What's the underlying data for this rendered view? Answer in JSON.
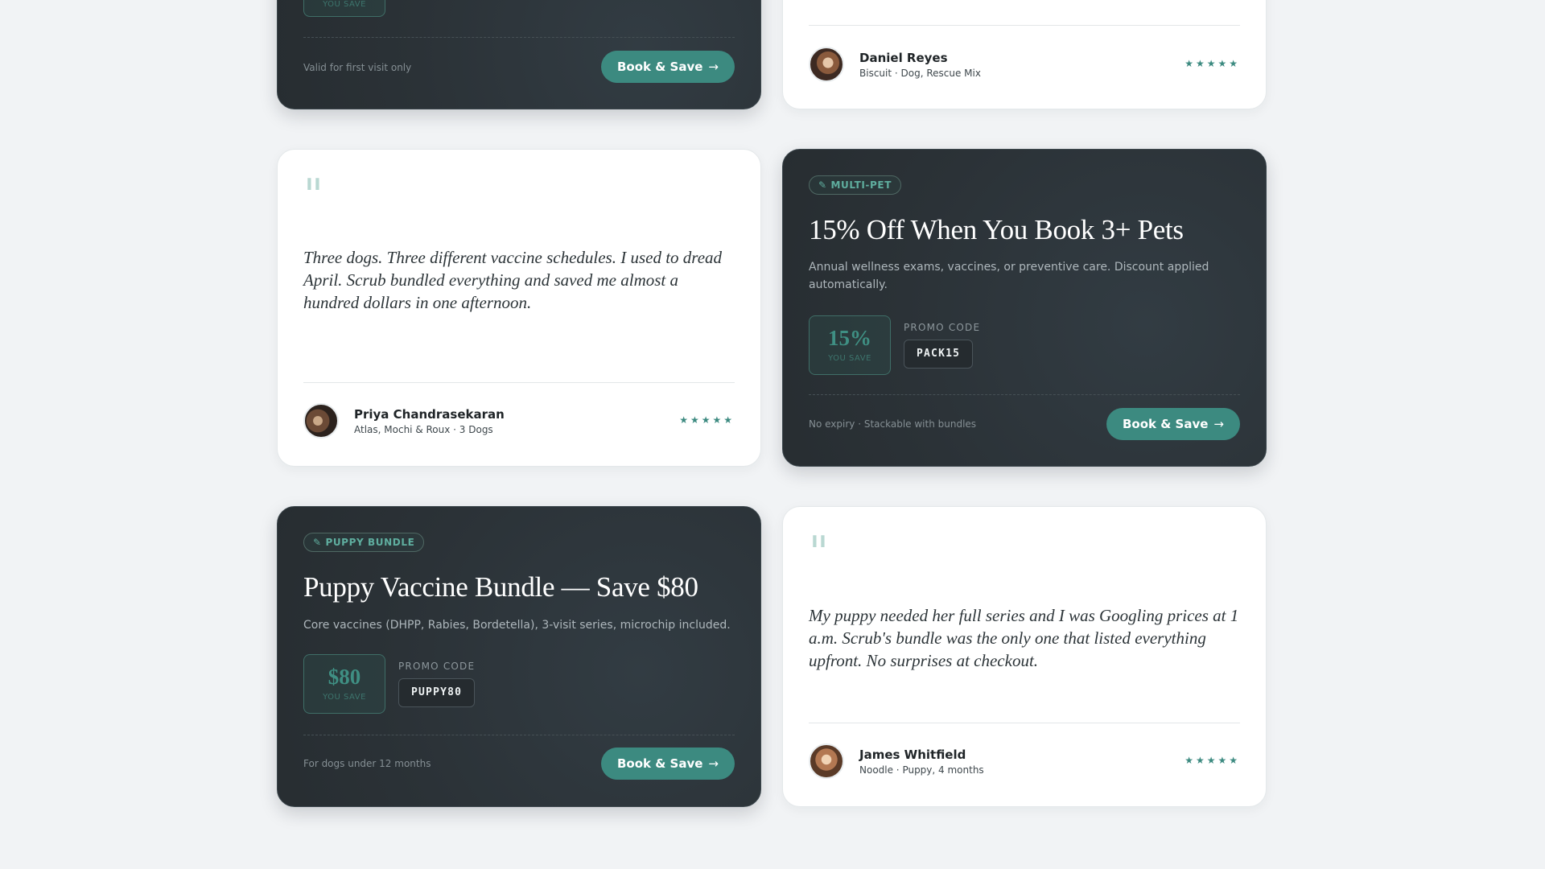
{
  "deals": [
    {
      "tag": null,
      "title": null,
      "description": null,
      "savings": "",
      "savings_label": "YOU SAVE",
      "promo_label": null,
      "promo_code": "",
      "note": "Valid for first visit only",
      "button": "Book & Save",
      "arrow": "→"
    },
    {
      "tag": "MULTI-PET",
      "title": "15% Off When You Book 3+ Pets",
      "description": "Annual wellness exams, vaccines, or preventive care. Discount applied automatically.",
      "savings": "15%",
      "savings_label": "YOU SAVE",
      "promo_label": "PROMO CODE",
      "promo_code": "PACK15",
      "note": "No expiry · Stackable with bundles",
      "button": "Book & Save",
      "arrow": "→"
    },
    {
      "tag": "PUPPY BUNDLE",
      "title": "Puppy Vaccine Bundle — Save $80",
      "description": "Core vaccines (DHPP, Rabies, Bordetella), 3-visit series, microchip included.",
      "savings": "$80",
      "savings_label": "YOU SAVE",
      "promo_label": "PROMO CODE",
      "promo_code": "PUPPY80",
      "note": "For dogs under 12 months",
      "button": "Book & Save",
      "arrow": "→"
    }
  ],
  "testimonials": [
    {
      "quote_mark": null,
      "quote": null,
      "name": "Daniel Reyes",
      "meta": "Biscuit · Dog, Rescue Mix",
      "stars": "★★★★★",
      "rating": 5
    },
    {
      "quote_mark": "\"",
      "quote": "Three dogs. Three different vaccine schedules. I used to dread April. Scrub bundled everything and saved me almost a hundred dollars in one afternoon.",
      "name": "Priya Chandrasekaran",
      "meta": "Atlas, Mochi & Roux · 3 Dogs",
      "stars": "★★★★★",
      "rating": 5
    },
    {
      "quote_mark": "\"",
      "quote": "My puppy needed her full series and I was Googling prices at 1 a.m. Scrub's bundle was the only one that listed everything upfront. No surprises at checkout.",
      "name": "James Whitfield",
      "meta": "Noodle · Puppy, 4 months",
      "stars": "★★★★★",
      "rating": 5
    }
  ],
  "colors": {
    "accent": "#3c8a80",
    "dark_card": "#2b3237",
    "background": "#f1f3f5"
  }
}
